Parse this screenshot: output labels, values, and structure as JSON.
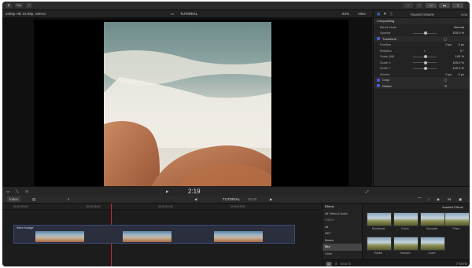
{
  "toolbar": {
    "import_label": "Fin"
  },
  "viewer_header": {
    "format": "1080p HD 23.98p, Stereo",
    "title": "TUTORIAL",
    "zoom": "84%",
    "view_label": "View"
  },
  "inspector": {
    "title": "TRANSFORMER",
    "duration": "0:00",
    "compositing": {
      "label": "Compositing",
      "blend_mode_label": "Blend Mode",
      "blend_mode_value": "Normal",
      "opacity_label": "Opacity",
      "opacity_value": "100.0 %"
    },
    "transform": {
      "label": "Transform",
      "rows": [
        {
          "label": "Position",
          "v1": "0 px",
          "v2": "0 px"
        },
        {
          "label": "Rotation",
          "v1": "",
          "v2": "0 °"
        },
        {
          "label": "Scale (All)",
          "v1": "",
          "v2": "100 %"
        },
        {
          "label": "Scale X",
          "v1": "",
          "v2": "100.0 %"
        },
        {
          "label": "Scale Y",
          "v1": "",
          "v2": "100.0 %"
        },
        {
          "label": "Anchor",
          "v1": "0 px",
          "v2": "0 px"
        }
      ]
    },
    "crop_label": "Crop",
    "distort_label": "Distort"
  },
  "transport": {
    "timecode": "2:19"
  },
  "timeline_bar": {
    "index_label": "Index",
    "project": "TUTORIAL",
    "project_time": "00:00"
  },
  "ruler": [
    "00:00:00:00",
    "00:00:05:00",
    "00:00:10:00",
    "00:00:15:00"
  ],
  "clip": {
    "name": "Wave footage"
  },
  "effects": {
    "header": "Effects",
    "installed_label": "Installed Effects",
    "categories": [
      "All Video & Audio",
      "VIDEO",
      "All",
      "360°",
      "Basics",
      "Blur",
      "Color"
    ],
    "selected": "Blur",
    "items": [
      "Directional",
      "Focus",
      "Gaussian",
      "Prism",
      "Radial",
      "Sharpen",
      "Zoom"
    ],
    "search_placeholder": "Search",
    "count": "7 items"
  },
  "colors": {
    "accent": "#4a56d6",
    "panel": "#1e1e1e"
  }
}
